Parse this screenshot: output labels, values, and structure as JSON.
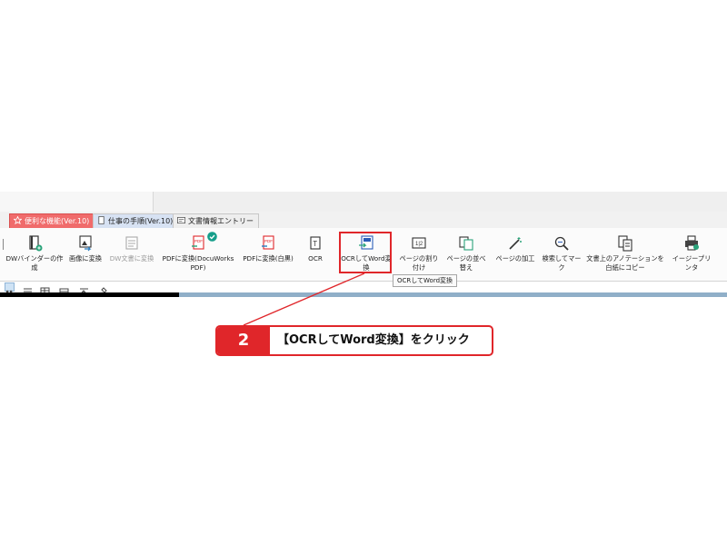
{
  "tabs": [
    {
      "label": "便利な機能(Ver.10)",
      "icon": "star-icon",
      "active": true
    },
    {
      "label": "仕事の手順(Ver.10)",
      "icon": "document-icon",
      "active": false
    },
    {
      "label": "文書情報エントリー",
      "icon": "card-icon",
      "active": false
    }
  ],
  "ribbon": {
    "items": [
      {
        "label": "DWバインダーの作成",
        "icon": "binder-icon",
        "enabled": true
      },
      {
        "label": "画像に変換",
        "icon": "image-convert-icon",
        "enabled": true
      },
      {
        "label": "DW文書に変換",
        "icon": "dw-convert-icon",
        "enabled": false
      },
      {
        "label": "PDFに変換(DocuWorks PDF)",
        "icon": "pdf-convert-icon",
        "enabled": true
      },
      {
        "label": "PDFに変換(白黒)",
        "icon": "pdf-mono-icon",
        "enabled": true
      },
      {
        "label": "OCR",
        "icon": "ocr-icon",
        "enabled": true
      },
      {
        "label": "OCRしてWord変換",
        "icon": "ocr-word-icon",
        "enabled": true
      },
      {
        "label": "ページの割り付け",
        "icon": "page-layout-icon",
        "enabled": true
      },
      {
        "label": "ページの並べ替え",
        "icon": "page-sort-icon",
        "enabled": true
      },
      {
        "label": "ページの加工",
        "icon": "page-edit-icon",
        "enabled": true
      },
      {
        "label": "検索してマーク",
        "icon": "search-mark-icon",
        "enabled": true
      },
      {
        "label": "文書上のアノテーションを白紙にコピー",
        "icon": "annotation-copy-icon",
        "enabled": true
      },
      {
        "label": "イージープリンタ",
        "icon": "printer-icon",
        "enabled": true
      }
    ]
  },
  "tooltip": "OCRしてWord変換",
  "callout": {
    "step": "2",
    "text": "【OCRしてWord変換】をクリック"
  },
  "colors": {
    "accent_red": "#e0262a",
    "tab_active": "#f06b6b",
    "tab_inactive": "#d7e2f3",
    "progress_blue": "#90afc8"
  }
}
